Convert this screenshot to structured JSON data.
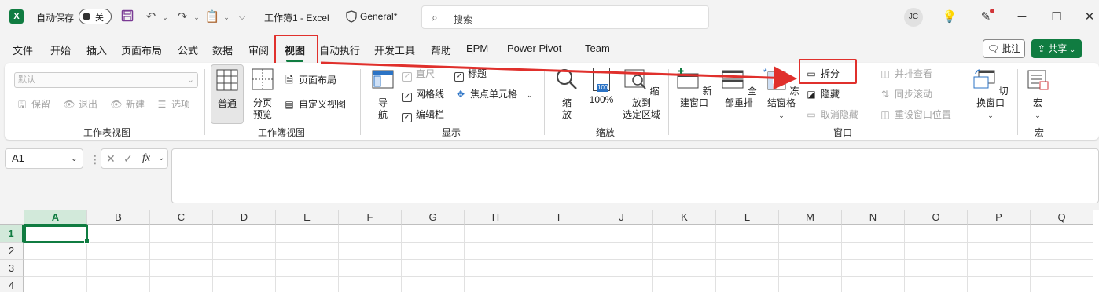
{
  "titlebar": {
    "autosave_label": "自动保存",
    "autosave_state": "关",
    "doc_title": "工作簿1  -  Excel",
    "sensitivity": "General*",
    "search_placeholder": "搜索",
    "avatar_initials": "JC"
  },
  "menu": {
    "tabs": [
      {
        "label": "文件"
      },
      {
        "label": "开始"
      },
      {
        "label": "插入"
      },
      {
        "label": "页面布局"
      },
      {
        "label": "公式"
      },
      {
        "label": "数据"
      },
      {
        "label": "审阅"
      },
      {
        "label": "视图"
      },
      {
        "label": "自动执行"
      },
      {
        "label": "开发工具"
      },
      {
        "label": "帮助"
      },
      {
        "label": "EPM"
      },
      {
        "label": "Power Pivot"
      },
      {
        "label": "Team"
      }
    ],
    "active_tab": "视图",
    "comment_label": "批注",
    "share_label": "共享"
  },
  "ribbon": {
    "sheet_view": {
      "dropdown_value": "默认",
      "keep": "保留",
      "exit": "退出",
      "new": "新建",
      "options": "选项",
      "label": "工作表视图"
    },
    "workbook_view": {
      "normal": "普通",
      "page_break_1": "分页",
      "page_break_2": "预览",
      "page_layout": "页面布局",
      "custom_views": "自定义视图",
      "label": "工作簿视图"
    },
    "show": {
      "nav_1": "导",
      "nav_2": "航",
      "ruler": "直尺",
      "headings": "标题",
      "gridlines": "网格线",
      "focus_cell": "焦点单元格",
      "formula_bar": "编辑栏",
      "label": "显示"
    },
    "zoom": {
      "zoom_1": "缩",
      "zoom_2": "放",
      "hundred": "100%",
      "hundred_icon": "100",
      "zoom_sel_1": "缩放到",
      "zoom_sel_2": "选定区域",
      "label": "缩放"
    },
    "window": {
      "new_window": "新建窗口",
      "arrange_all": "全部重排",
      "freeze_panes": "冻结窗格",
      "split": "拆分",
      "hide": "隐藏",
      "unhide": "取消隐藏",
      "side_by_side": "并排查看",
      "sync_scroll": "同步滚动",
      "reset_position": "重设窗口位置",
      "switch_windows": "切换窗口",
      "label": "窗口"
    },
    "macros": {
      "macros": "宏",
      "label": "宏"
    }
  },
  "formula_bar": {
    "name_box": "A1",
    "fx": "fx"
  },
  "grid": {
    "columns": [
      "A",
      "B",
      "C",
      "D",
      "E",
      "F",
      "G",
      "H",
      "I",
      "J",
      "K",
      "L",
      "M",
      "N",
      "O",
      "P",
      "Q"
    ],
    "rows": [
      "1",
      "2",
      "3",
      "4"
    ],
    "selected_cell": "A1"
  },
  "colors": {
    "accent": "#107c41",
    "highlight": "#e0302c"
  }
}
